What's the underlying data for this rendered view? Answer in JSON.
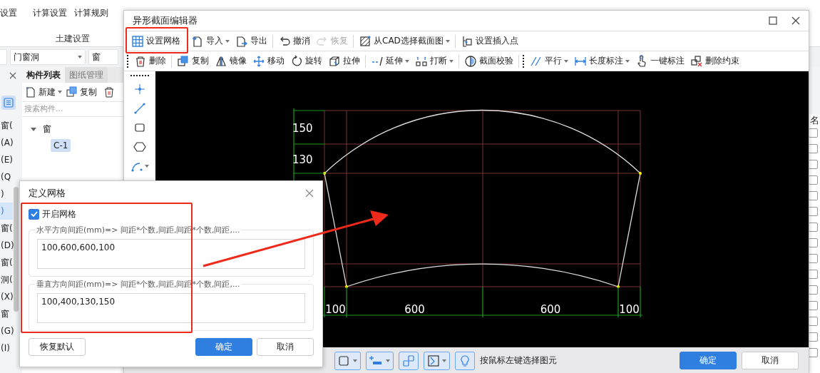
{
  "main_app": {
    "ribbon": {
      "buttons": [
        {
          "label": "设置"
        },
        {
          "label": "计算设置"
        },
        {
          "label": "计算规则"
        }
      ],
      "group_label": "土建设置"
    },
    "filters": [
      {
        "value": "门窗洞"
      },
      {
        "value": "窗"
      }
    ],
    "left_list": [
      {
        "label": "窗(",
        "selected": false
      },
      {
        "label": "(A)",
        "selected": false
      },
      {
        "label": "(E)",
        "selected": false
      },
      {
        "label": "(Q",
        "selected": false
      },
      {
        "label": ")",
        "selected": false
      },
      {
        "label": ")",
        "selected": true
      },
      {
        "label": "窗(",
        "selected": false
      },
      {
        "label": "(D)",
        "selected": false
      },
      {
        "label": "窗(",
        "selected": false
      },
      {
        "label": "洞(",
        "selected": false
      },
      {
        "label": "(X)",
        "selected": false
      },
      {
        "label": "窗",
        "selected": false
      },
      {
        "label": "(G)",
        "selected": false
      },
      {
        "label": "(I)",
        "selected": false
      }
    ],
    "panel": {
      "tabs": [
        {
          "label": "构件列表",
          "selected": true
        },
        {
          "label": "图纸管理",
          "selected": false
        }
      ],
      "toolbar": [
        {
          "label": "新建",
          "dropdown": true
        },
        {
          "label": "复制",
          "dropdown": false
        }
      ],
      "search": {
        "placeholder": "搜索构件..."
      },
      "tree": [
        {
          "label": "窗",
          "expanded": true,
          "selected": false,
          "children": [
            {
              "label": "C-1",
              "selected": true
            }
          ]
        }
      ]
    },
    "right_column": {
      "header": "名",
      "checkboxes": [
        {
          "checked": false
        },
        {
          "checked": false
        },
        {
          "checked": false
        },
        {
          "checked": false
        },
        {
          "checked": false
        },
        {
          "checked": false
        },
        {
          "checked": false
        },
        {
          "checked": false
        },
        {
          "checked": false
        },
        {
          "checked": false
        },
        {
          "checked": false
        },
        {
          "checked": false
        },
        {
          "checked": false
        },
        {
          "checked": false
        },
        {
          "checked": false
        }
      ]
    }
  },
  "editor": {
    "title": "异形截面编辑器",
    "toolbar_1": [
      [
        {
          "label": "设置网格",
          "dropdown": false,
          "disabled": false
        },
        {
          "label": "导入",
          "dropdown": true,
          "disabled": false
        },
        {
          "label": "导出",
          "dropdown": false,
          "disabled": false
        }
      ],
      [
        {
          "label": "撤消",
          "dropdown": false,
          "disabled": false
        },
        {
          "label": "恢复",
          "dropdown": false,
          "disabled": true
        }
      ],
      [
        {
          "label": "从CAD选择截面图",
          "dropdown": true,
          "disabled": false
        }
      ],
      [
        {
          "label": "设置插入点",
          "dropdown": false,
          "disabled": false
        }
      ]
    ],
    "toolbar_2": [
      [
        {
          "label": "删除",
          "dropdown": false,
          "disabled": false
        }
      ],
      [
        {
          "label": "复制",
          "dropdown": false,
          "disabled": false
        },
        {
          "label": "镜像",
          "dropdown": false,
          "disabled": false
        },
        {
          "label": "移动",
          "dropdown": false,
          "disabled": false
        },
        {
          "label": "旋转",
          "dropdown": false,
          "disabled": false
        },
        {
          "label": "拉伸",
          "dropdown": false,
          "disabled": false
        }
      ],
      [
        {
          "label": "延伸",
          "dropdown": true,
          "disabled": false
        },
        {
          "label": "打断",
          "dropdown": true,
          "disabled": false
        }
      ],
      [
        {
          "label": "截面校验",
          "dropdown": false,
          "disabled": false
        }
      ]
    ],
    "toolbar_3": [
      [
        {
          "label": "平行",
          "dropdown": true,
          "disabled": false
        },
        {
          "label": "长度标注",
          "dropdown": true,
          "disabled": false
        },
        {
          "label": "一键标注",
          "dropdown": false,
          "disabled": false
        },
        {
          "label": "删除约束",
          "dropdown": false,
          "disabled": false
        }
      ]
    ],
    "canvas": {
      "vertical_dims": [
        "150",
        "130"
      ],
      "horizontal_dims": [
        "100",
        "600",
        "600",
        "100"
      ]
    },
    "status_hint": "按鼠标左键选择图元",
    "buttons": [
      {
        "label": "确定",
        "primary": true
      },
      {
        "label": "取消",
        "primary": false
      }
    ]
  },
  "dialog": {
    "title": "定义网格",
    "enable_grid": {
      "label": "开启网格",
      "checked": true
    },
    "groups": [
      {
        "label": "水平方向间距(mm)=> 间距*个数,间距,间距*个数,间距,...",
        "value": "100,600,600,100"
      },
      {
        "label": "垂直方向间距(mm)=> 间距*个数,间距,间距*个数,间距,...",
        "value": "100,400,130,150"
      }
    ],
    "buttons": [
      {
        "label": "恢复默认",
        "primary": false
      },
      {
        "label": "确定",
        "primary": true
      },
      {
        "label": "取消",
        "primary": false
      }
    ]
  }
}
